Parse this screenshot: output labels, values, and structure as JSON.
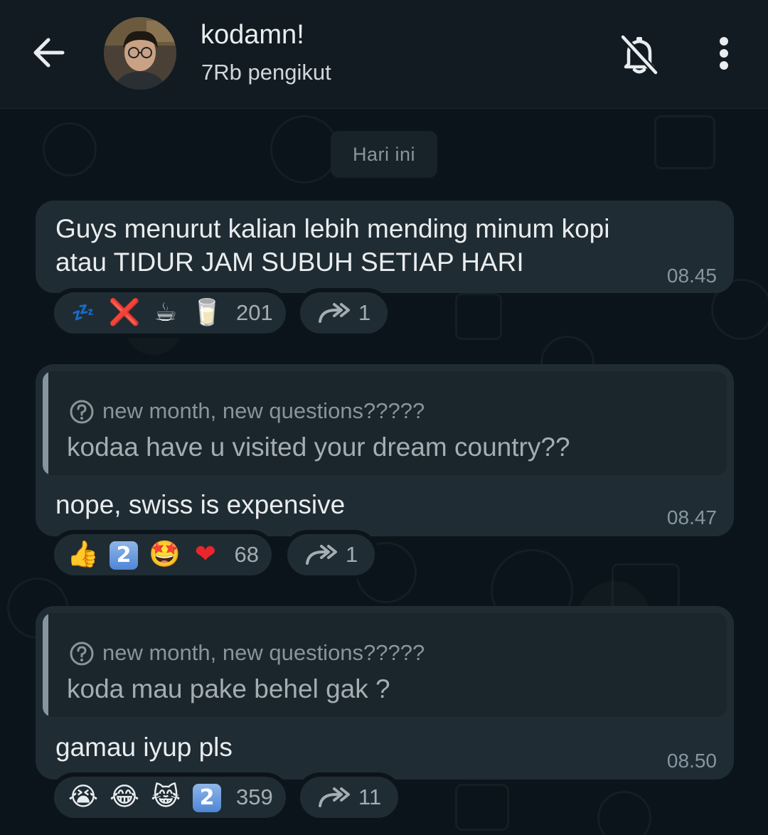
{
  "header": {
    "title": "kodamn!",
    "subtitle": "7Rb pengikut"
  },
  "date_chip": "Hari ini",
  "messages": [
    {
      "text_line1": "Guys menurut kalian lebih mending minum kopi",
      "text_line2": "atau TIDUR JAM SUBUH SETIAP HARI",
      "time": "08.45",
      "reactions": [
        "💤",
        "❌",
        "☕",
        "🥛"
      ],
      "reaction_count": "201",
      "forward_count": "1"
    },
    {
      "quote_header": "new month, new questions?????",
      "quote_body": "kodaa have u visited your dream country??",
      "text": "nope, swiss is expensive",
      "time": "08.47",
      "reactions": [
        "👍",
        "2",
        "🤩",
        "❤"
      ],
      "reaction_count": "68",
      "forward_count": "1"
    },
    {
      "quote_header": "new month, new questions?????",
      "quote_body": "koda mau pake behel gak ?",
      "text": "gamau iyup pls",
      "time": "08.50",
      "reactions": [
        "😭",
        "😂",
        "😹",
        "2"
      ],
      "reaction_count": "359",
      "forward_count": "11"
    }
  ],
  "icons": {
    "back": "back-arrow-icon",
    "mute": "bell-off-icon",
    "menu": "kebab-menu-icon",
    "forward": "forward-icon",
    "question": "question-circle-icon"
  },
  "colors": {
    "background": "#0b141a",
    "header": "#111b21",
    "bubble": "#202c33",
    "secondary_text": "#8696a0"
  }
}
